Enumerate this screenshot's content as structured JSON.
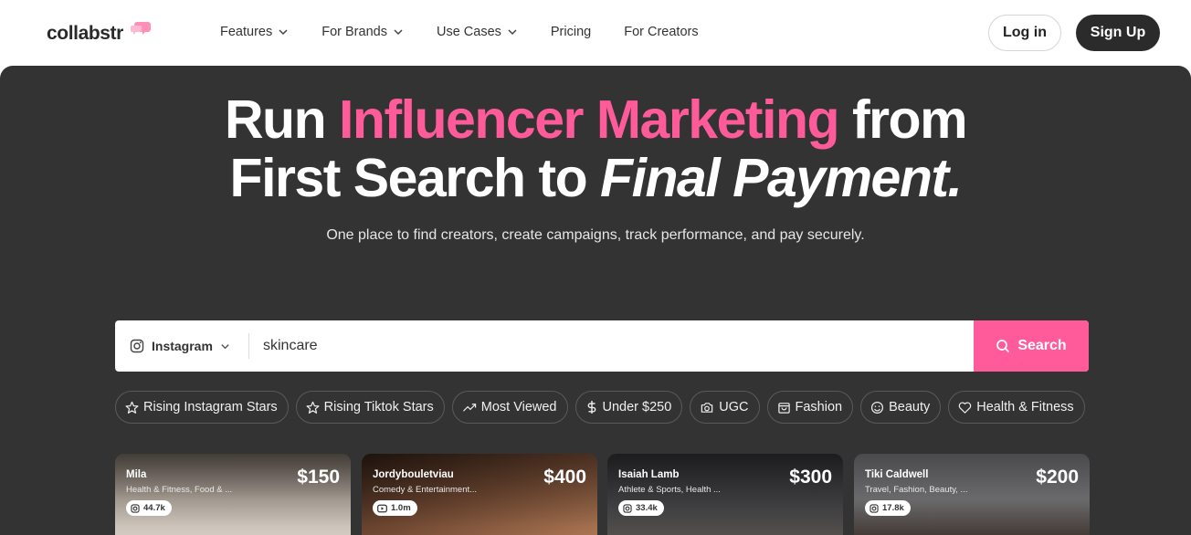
{
  "brand": {
    "name": "collabstr",
    "accent": "#ff5b9a",
    "dark": "#333333"
  },
  "nav": {
    "items": [
      {
        "label": "Features",
        "dropdown": true
      },
      {
        "label": "For Brands",
        "dropdown": true
      },
      {
        "label": "Use Cases",
        "dropdown": true
      },
      {
        "label": "Pricing",
        "dropdown": false
      },
      {
        "label": "For Creators",
        "dropdown": false
      }
    ],
    "login": "Log in",
    "signup": "Sign Up"
  },
  "hero": {
    "line1_a": "Run ",
    "line1_pink": "Influencer Marketing",
    "line1_b": " from",
    "line2_a": "First Search to ",
    "line2_italic": "Final Payment.",
    "subtitle": "One place to find creators, create campaigns, track performance, and pay securely."
  },
  "search": {
    "platform": "Instagram",
    "platform_icon": "instagram-icon",
    "query": "skincare",
    "button": "Search"
  },
  "chips": [
    {
      "label": "Rising Instagram Stars",
      "icon": "star-icon"
    },
    {
      "label": "Rising Tiktok Stars",
      "icon": "star-icon"
    },
    {
      "label": "Most Viewed",
      "icon": "trending-icon"
    },
    {
      "label": "Under $250",
      "icon": "dollar-icon"
    },
    {
      "label": "UGC",
      "icon": "camera-icon"
    },
    {
      "label": "Fashion",
      "icon": "bag-icon"
    },
    {
      "label": "Beauty",
      "icon": "smile-icon"
    },
    {
      "label": "Health & Fitness",
      "icon": "heart-icon"
    }
  ],
  "cards": [
    {
      "name": "Mila",
      "categories": "Health & Fitness, Food & ...",
      "price": "$150",
      "followers": "44.7k",
      "platform_icon": "instagram-icon"
    },
    {
      "name": "Jordybouletviau",
      "categories": "Comedy & Entertainment...",
      "price": "$400",
      "followers": "1.0m",
      "platform_icon": "youtube-icon"
    },
    {
      "name": "Isaiah Lamb",
      "categories": "Athlete & Sports, Health ...",
      "price": "$300",
      "followers": "33.4k",
      "platform_icon": "instagram-icon"
    },
    {
      "name": "Tiki Caldwell",
      "categories": "Travel, Fashion, Beauty, ...",
      "price": "$200",
      "followers": "17.8k",
      "platform_icon": "instagram-icon"
    }
  ]
}
